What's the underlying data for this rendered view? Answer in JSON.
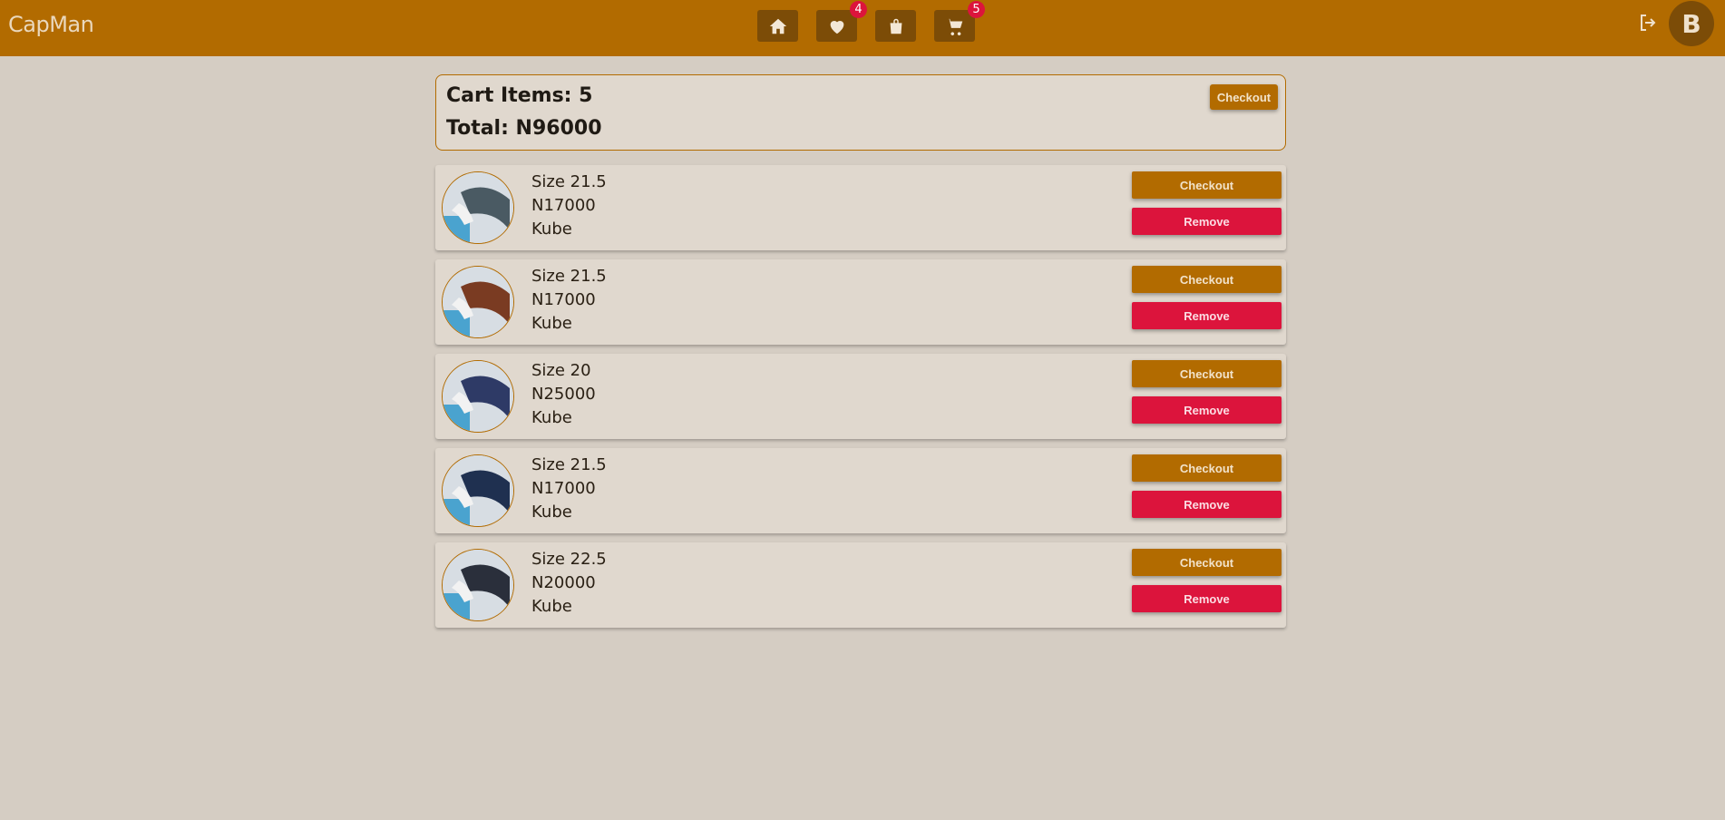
{
  "header": {
    "brand": "CapMan",
    "nav": [
      {
        "name": "home-icon"
      },
      {
        "name": "heart-icon",
        "badge": "4"
      },
      {
        "name": "shopping-bag-icon"
      },
      {
        "name": "cart-icon",
        "badge": "5"
      }
    ],
    "avatar_initial": "B",
    "colors": {
      "bar": "#b26b00",
      "button": "#7c4c07",
      "badge": "#dc143c"
    }
  },
  "summary": {
    "count_text": "Cart Items: 5",
    "total_text": "Total: N96000",
    "checkout_label": "Checkout"
  },
  "items": [
    {
      "size": "Size 21.5",
      "price": "N17000",
      "brand": "Kube",
      "checkout_label": "Checkout",
      "remove_label": "Remove",
      "cap_color": "#4a5a63"
    },
    {
      "size": "Size 21.5",
      "price": "N17000",
      "brand": "Kube",
      "checkout_label": "Checkout",
      "remove_label": "Remove",
      "cap_color": "#7a3b22"
    },
    {
      "size": "Size 20",
      "price": "N25000",
      "brand": "Kube",
      "checkout_label": "Checkout",
      "remove_label": "Remove",
      "cap_color": "#2e3a66"
    },
    {
      "size": "Size 21.5",
      "price": "N17000",
      "brand": "Kube",
      "checkout_label": "Checkout",
      "remove_label": "Remove",
      "cap_color": "#1f3050"
    },
    {
      "size": "Size 22.5",
      "price": "N20000",
      "brand": "Kube",
      "checkout_label": "Checkout",
      "remove_label": "Remove",
      "cap_color": "#2a2f3b"
    }
  ]
}
